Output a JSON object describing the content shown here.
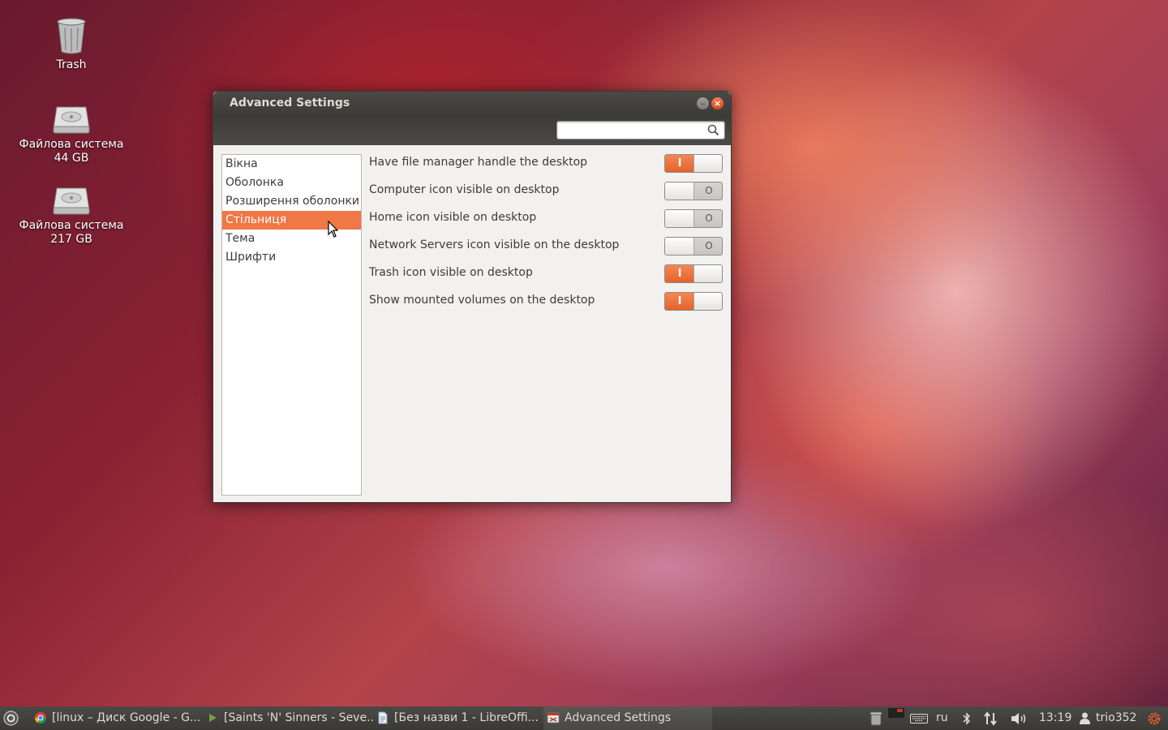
{
  "desktop": {
    "icons": [
      {
        "label": "Trash"
      },
      {
        "label": "Файлова система",
        "size": "44 GB"
      },
      {
        "label": "Файлова система",
        "size": "217 GB"
      }
    ]
  },
  "window": {
    "title": "Advanced Settings",
    "search": {
      "value": "",
      "placeholder": ""
    },
    "sidebar": {
      "items": [
        {
          "label": "Вікна",
          "selected": false
        },
        {
          "label": "Оболонка",
          "selected": false
        },
        {
          "label": "Розширення оболонки",
          "selected": false
        },
        {
          "label": "Стільниця",
          "selected": true
        },
        {
          "label": "Тема",
          "selected": false
        },
        {
          "label": "Шрифти",
          "selected": false
        }
      ]
    },
    "settings": [
      {
        "label": "Have file manager handle the desktop",
        "on": true
      },
      {
        "label": "Computer icon visible on desktop",
        "on": false
      },
      {
        "label": "Home icon visible on desktop",
        "on": false
      },
      {
        "label": "Network Servers icon visible on the desktop",
        "on": false
      },
      {
        "label": "Trash icon visible on desktop",
        "on": true
      },
      {
        "label": "Show mounted volumes on the desktop",
        "on": true
      }
    ],
    "toggle_on_glyph": "I",
    "toggle_off_glyph": "O"
  },
  "panel": {
    "tasks": [
      {
        "label": "[linux – Диск Google - G...",
        "icon": "chrome-icon"
      },
      {
        "label": "[Saints 'N' Sinners - Seve...",
        "icon": "media-player-icon"
      },
      {
        "label": "[Без назви 1 - LibreOffi...",
        "icon": "document-icon"
      },
      {
        "label": "Advanced Settings",
        "icon": "tweak-tool-icon"
      }
    ],
    "keyboard_layout": "ru",
    "time": "13:19",
    "user": "trio352"
  },
  "colors": {
    "accent": "#f07746",
    "titlebar": "#3c3b37",
    "window_bg": "#f2f1f0"
  }
}
